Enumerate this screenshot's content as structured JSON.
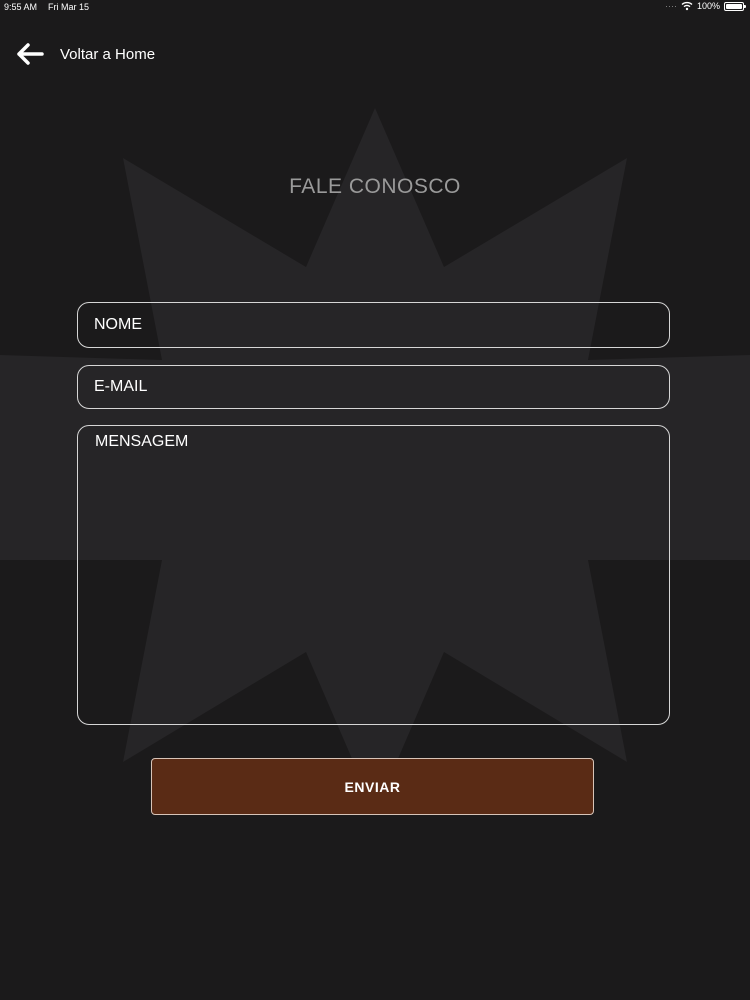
{
  "status_bar": {
    "time": "9:55 AM",
    "date": "Fri Mar 15",
    "signal_icon": "signal-dots-icon",
    "wifi_icon": "wifi-icon",
    "battery_percent": "100%",
    "battery_level": 1.0,
    "battery_icon": "battery-icon"
  },
  "nav": {
    "back_icon": "back-arrow-icon",
    "back_label": "Voltar a Home"
  },
  "page": {
    "title": "FALE CONOSCO"
  },
  "form": {
    "name_placeholder": "NOME",
    "email_placeholder": "E-MAIL",
    "message_placeholder": "MENSAGEM",
    "submit_label": "ENVIAR"
  },
  "colors": {
    "background": "#1b1a1b",
    "star_watermark": "#262527",
    "button_fill": "#5a2b15",
    "field_border": "#d6d6d6",
    "title_text": "#9a9a9a"
  }
}
